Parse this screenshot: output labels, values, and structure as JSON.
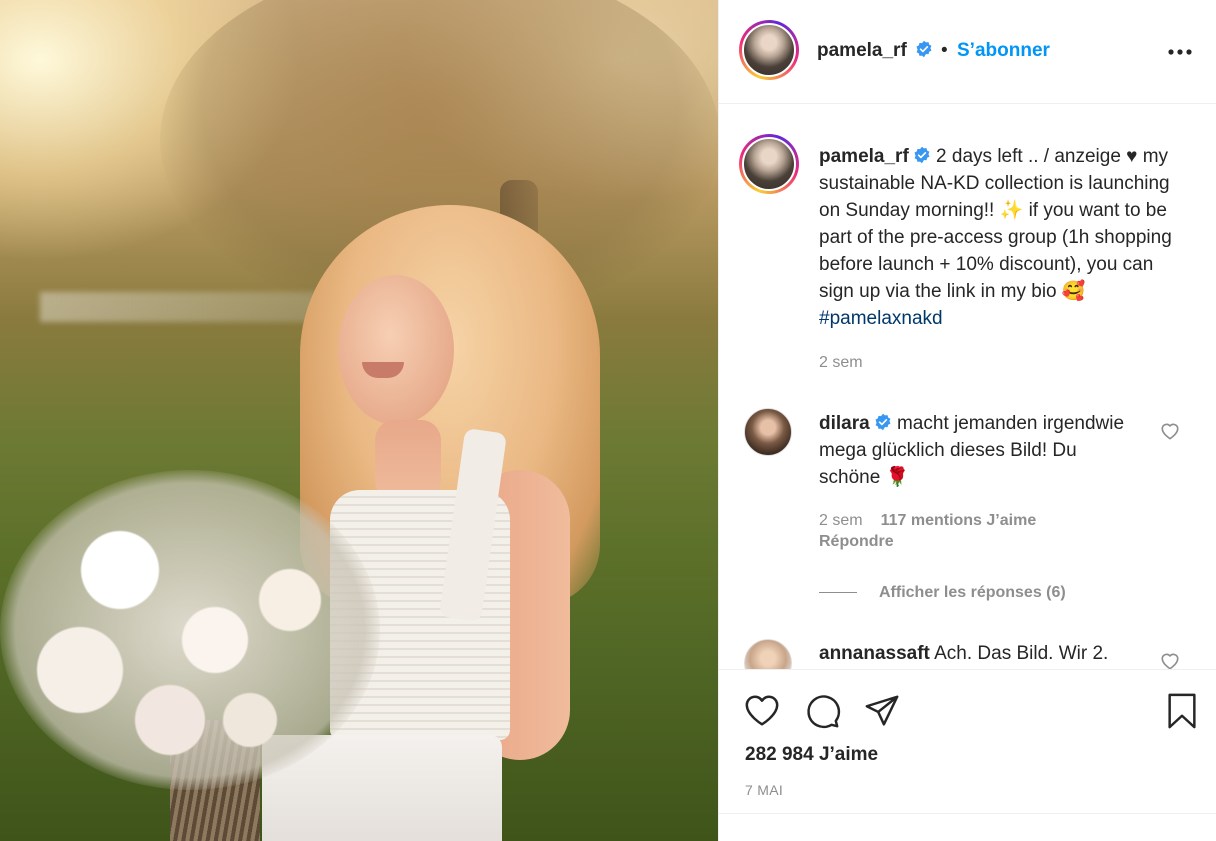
{
  "post": {
    "author": "pamela_rf",
    "follow_label": "S’abonner",
    "separator": "•",
    "caption": {
      "username": "pamela_rf",
      "text": " 2 days left .. / anzeige ♥︎ my sustainable NA-KD collection is launching on Sunday morning!! ",
      "emoji1": "✨",
      "text2": " if you want to be part of the pre-access group (1h shopping before launch + 10% discount), you can sign up via the link in my bio ",
      "emoji2": "🥰",
      "hashtag": "#pamelaxnakd",
      "time": "2 sem"
    },
    "likes": "282 984 J’aime",
    "date": "7 MAI"
  },
  "comments": [
    {
      "username": "dilara",
      "text": " macht jemanden irgendwie mega glücklich dieses Bild! Du schöne ",
      "emoji": "🌹",
      "time": "2 sem",
      "likes": "117 mentions J’aime",
      "reply": "Répondre",
      "view_replies": "Afficher les réponses (6)"
    },
    {
      "username": "annanassaft",
      "text": " Ach. Das Bild. Wir 2."
    }
  ],
  "icons": [
    "more-options-icon",
    "verified-badge-icon",
    "like-heart-icon",
    "comment-icon",
    "share-icon",
    "bookmark-icon",
    "comment-like-icon"
  ],
  "colors": {
    "accent": "#0095f6",
    "verified": "#3897f0",
    "hashtag": "#00376b",
    "muted": "#8e8e8e",
    "text": "#262626"
  }
}
